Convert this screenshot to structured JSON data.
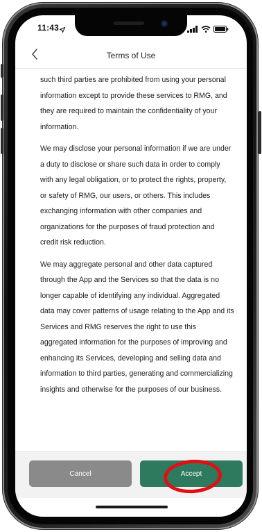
{
  "status_bar": {
    "time": "11:43",
    "location_icon": "location-arrow-icon",
    "signal_icon": "cellular-signal-icon",
    "wifi_icon": "wifi-icon",
    "battery_icon": "battery-icon"
  },
  "nav": {
    "back_icon": "chevron-left-icon",
    "title": "Terms of Use"
  },
  "content": {
    "paragraphs": [
      "such third parties are prohibited from using your personal information except to provide these services to RMG, and they are required to maintain the confidentiality of your information.",
      "We may disclose your personal information if we are under a duty to disclose or share such data in order to comply with any legal obligation, or to protect the rights, property, or safety of RMG, our users, or others. This includes exchanging information with other companies and organizations for the purposes of fraud protection and credit risk reduction.",
      "We may aggregate personal and other data captured through the App and the Services so that the data is no longer capable of identifying any individual. Aggregated data may cover patterns of usage relating to the App and its Services and RMG reserves the right to use this aggregated information for the purposes of improving and enhancing its Services, developing and selling data and information to third parties, generating and commercializing insights and otherwise for the purposes of our business."
    ]
  },
  "footer": {
    "cancel_label": "Cancel",
    "accept_label": "Accept"
  },
  "colors": {
    "accept_button": "#2e7a5f",
    "cancel_button": "#8a8a8a",
    "highlight_circle": "#e10e12"
  }
}
